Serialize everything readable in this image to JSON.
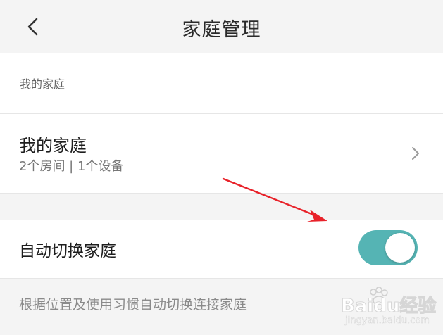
{
  "header": {
    "title": "家庭管理",
    "back_icon": "chevron-left-icon"
  },
  "section": {
    "label": "我的家庭"
  },
  "home": {
    "name": "我的家庭",
    "meta": "2个房间 | 1个设备",
    "chevron_icon": "chevron-right-icon"
  },
  "auto_switch": {
    "label": "自动切换家庭",
    "enabled": true,
    "description": "根据位置及使用习惯自动切换连接家庭"
  },
  "watermark": {
    "brand": "Baidu经验",
    "url": "jingyan.baidu.com"
  },
  "colors": {
    "toggle_on": "#55b4b4",
    "annotation_arrow": "#e8222a"
  }
}
